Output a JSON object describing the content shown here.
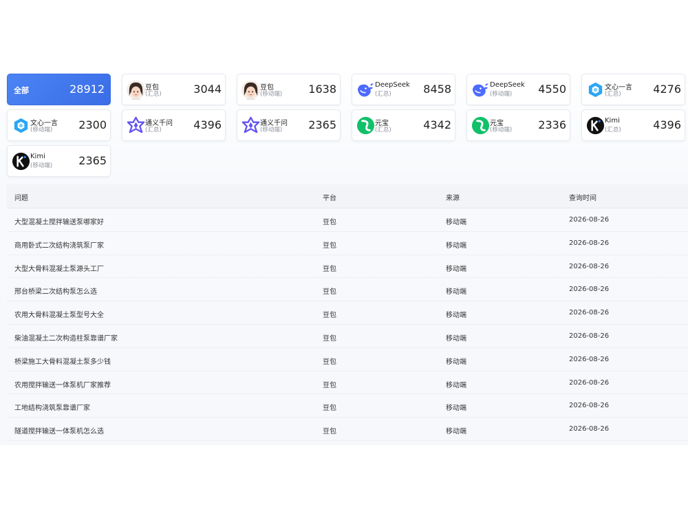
{
  "summary": {
    "all_label": "全部",
    "all_count": "28912"
  },
  "cards": [
    {
      "name": "豆包",
      "sub": "(汇总)",
      "count": "3044",
      "icon": "doubao-avatar-icon"
    },
    {
      "name": "豆包",
      "sub": "(移动端)",
      "count": "1638",
      "icon": "doubao-avatar-icon"
    },
    {
      "name": "DeepSeek",
      "sub": "(汇总)",
      "count": "8458",
      "icon": "deepseek-whale-icon"
    },
    {
      "name": "DeepSeek",
      "sub": "(移动端)",
      "count": "4550",
      "icon": "deepseek-whale-icon"
    },
    {
      "name": "文心一言",
      "sub": "(汇总)",
      "count": "4276",
      "icon": "wenxin-cube-icon"
    },
    {
      "name": "文心一言",
      "sub": "(移动端)",
      "count": "2300",
      "icon": "wenxin-cube-icon"
    },
    {
      "name": "通义千问",
      "sub": "(汇总)",
      "count": "4396",
      "icon": "tongyi-star-icon"
    },
    {
      "name": "通义千问",
      "sub": "(移动端)",
      "count": "2365",
      "icon": "tongyi-star-icon"
    },
    {
      "name": "元宝",
      "sub": "(汇总)",
      "count": "4342",
      "icon": "yuanbao-icon"
    },
    {
      "name": "元宝",
      "sub": "(移动端)",
      "count": "2336",
      "icon": "yuanbao-icon"
    },
    {
      "name": "Kimi",
      "sub": "(汇总)",
      "count": "4396",
      "icon": "kimi-icon"
    },
    {
      "name": "Kimi",
      "sub": "(移动端)",
      "count": "2365",
      "icon": "kimi-icon"
    }
  ],
  "table": {
    "headers": [
      "问题",
      "平台",
      "来源",
      "查询时间"
    ],
    "rows": [
      [
        "大型混凝土搅拌输送泵哪家好",
        "豆包",
        "移动端",
        "2026-08-26"
      ],
      [
        "商用卧式二次结构浇筑泵厂家",
        "豆包",
        "移动端",
        "2026-08-26"
      ],
      [
        "大型大骨料混凝土泵源头工厂",
        "豆包",
        "移动端",
        "2026-08-26"
      ],
      [
        "邢台桥梁二次结构泵怎么选",
        "豆包",
        "移动端",
        "2026-08-26"
      ],
      [
        "农用大骨料混凝土泵型号大全",
        "豆包",
        "移动端",
        "2026-08-26"
      ],
      [
        "柴油混凝土二次构造柱泵靠谱厂家",
        "豆包",
        "移动端",
        "2026-08-26"
      ],
      [
        "桥梁施工大骨料混凝土泵多少钱",
        "豆包",
        "移动端",
        "2026-08-26"
      ],
      [
        "农用搅拌输送一体泵机厂家推荐",
        "豆包",
        "移动端",
        "2026-08-26"
      ],
      [
        "工地结构浇筑泵靠谱厂家",
        "豆包",
        "移动端",
        "2026-08-26"
      ],
      [
        "隧道搅拌输送一体泵机怎么选",
        "豆包",
        "移动端",
        "2026-08-26"
      ]
    ]
  }
}
